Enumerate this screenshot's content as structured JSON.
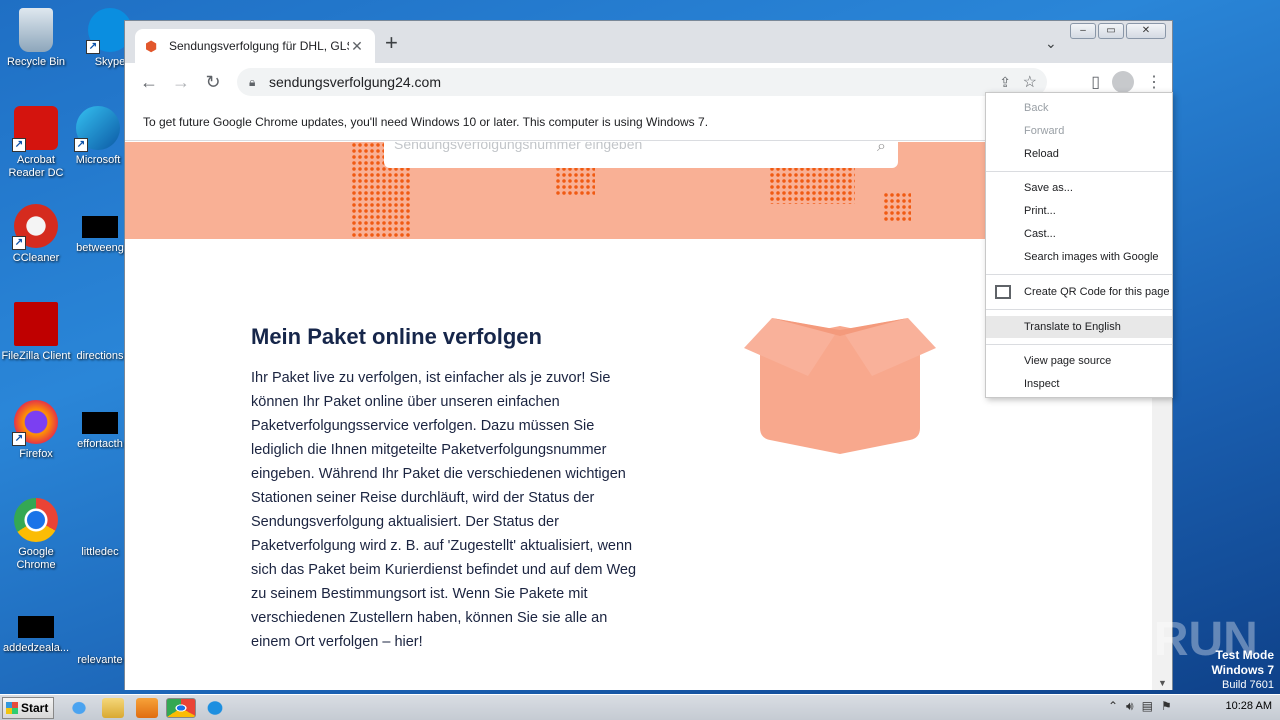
{
  "desktop": {
    "icons": [
      {
        "label": "Recycle Bin"
      },
      {
        "label": "Skype"
      },
      {
        "label": "Acrobat Reader DC"
      },
      {
        "label": "Microsoft"
      },
      {
        "label": "CCleaner"
      },
      {
        "label": "betweeng"
      },
      {
        "label": "FileZilla Client"
      },
      {
        "label": "directions"
      },
      {
        "label": "Firefox"
      },
      {
        "label": "effortacth"
      },
      {
        "label": "Google Chrome"
      },
      {
        "label": "littledec"
      },
      {
        "label": "addedzeala..."
      },
      {
        "label": "relevante"
      }
    ]
  },
  "browser": {
    "tab_title": "Sendungsverfolgung für DHL, GLS, U",
    "url": "sendungsverfolgung24.com",
    "infobar": "To get future Google Chrome updates, you'll need Windows 10 or later. This computer is using Windows 7."
  },
  "page": {
    "search_placeholder": "Sendungsverfolgungsnummer eingeben",
    "heading": "Mein Paket online verfolgen",
    "body": "Ihr Paket live zu verfolgen, ist einfacher als je zuvor! Sie können Ihr Paket online über unseren einfachen Paketverfolgungsservice verfolgen. Dazu müssen Sie lediglich die Ihnen mitgeteilte Paketverfolgungsnummer eingeben. Während Ihr Paket die verschiedenen wichtigen Stationen seiner Reise durchläuft, wird der Status der Sendungsverfolgung aktualisiert. Der Status der Paketverfolgung wird z. B. auf 'Zugestellt' aktualisiert, wenn sich das Paket beim Kurierdienst befindet und auf dem Weg zu seinem Bestimmungsort ist. Wenn Sie Pakete mit verschiedenen Zustellern haben, können Sie sie alle an einem Ort verfolgen – hier!"
  },
  "context_menu": {
    "back": "Back",
    "forward": "Forward",
    "reload": "Reload",
    "save_as": "Save as...",
    "print": "Print...",
    "cast": "Cast...",
    "search_images": "Search images with Google",
    "qr_code": "Create QR Code for this page",
    "translate": "Translate to English",
    "view_source": "View page source",
    "inspect": "Inspect"
  },
  "taskbar": {
    "start_label": "Start",
    "clock": "10:28 AM"
  },
  "overlay": {
    "watermark": "ANY RUN",
    "test_mode": "Test Mode",
    "os": "Windows 7",
    "build": "Build 7601"
  }
}
